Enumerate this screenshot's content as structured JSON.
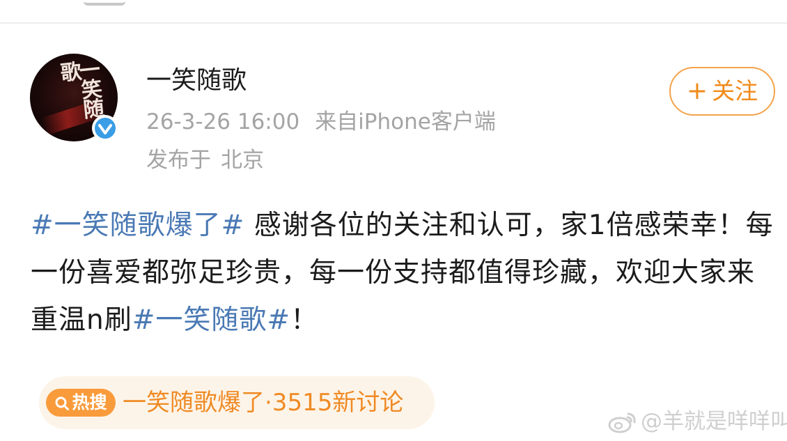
{
  "user": {
    "name": "一笑随歌",
    "avatar_text": "一笑随歌",
    "verified": true
  },
  "meta": {
    "date_time": "26-3-26 16:00",
    "source": "来自iPhone客户端",
    "location_prefix": "发布于",
    "location": "北京"
  },
  "follow": {
    "plus": "+",
    "label": "关注"
  },
  "post": {
    "hashtag_1": "#一笑随歌爆了#",
    "text_1": " 感谢各位的关注和认可，家1倍感荣幸！每一份喜爱都弥足珍贵，每一份支持都值得珍藏，欢迎大家来重温n刷",
    "hashtag_2": "#一笑随歌#",
    "text_2": "！"
  },
  "hot_search": {
    "tag_label": "热搜",
    "text": "一笑随歌爆了·3515新讨论"
  },
  "watermark": {
    "text": "@羊就是咩咩叫"
  },
  "colors": {
    "hashtag": "#4a79b4",
    "accent_orange": "#f08a1a",
    "hot_chip_bg": "#fdf4e9",
    "verified_blue": "#3a9de6",
    "meta_gray": "#a4a4a4"
  }
}
